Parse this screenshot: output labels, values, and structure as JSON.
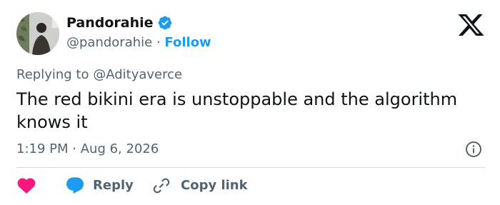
{
  "author": {
    "name": "Pandorahie",
    "handle": "@pandorahie",
    "separator": "·",
    "follow_label": "Follow",
    "verified": true
  },
  "reply_context": {
    "prefix": "Replying to",
    "mention": "@Adityaverce"
  },
  "tweet": {
    "text": "The red bikini era is unstoppable and the algorithm knows it",
    "time": "1:19 PM",
    "separator": "·",
    "date": "Aug 6, 2026"
  },
  "actions": {
    "reply_label": "Reply",
    "copy_label": "Copy link"
  },
  "icons": {
    "brand": "x-logo-icon",
    "verified": "verified-badge-icon",
    "info": "info-icon",
    "like": "heart-icon",
    "reply": "speech-bubble-icon",
    "copy": "link-icon"
  },
  "colors": {
    "accent": "#1d9bf0",
    "like": "#f91880",
    "text": "#0f1419",
    "secondary": "#536471",
    "divider": "#cfd9de"
  }
}
